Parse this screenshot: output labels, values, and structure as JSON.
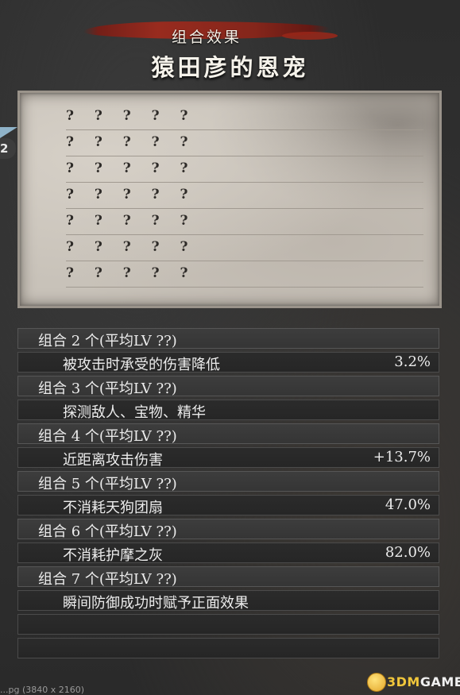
{
  "header": {
    "subtitle": "组合效果",
    "title": "猿田彦的恩宠"
  },
  "side_tab": {
    "badge": "2"
  },
  "unknown_slots": [
    "? ? ? ? ?",
    "? ? ? ? ?",
    "? ? ? ? ?",
    "? ? ? ? ?",
    "? ? ? ? ?",
    "? ? ? ? ?",
    "? ? ? ? ?"
  ],
  "combos": [
    {
      "header": "组合 2 个(平均LV  ??)",
      "effect": "被攻击时承受的伤害降低",
      "value": "3.2%"
    },
    {
      "header": "组合 3 个(平均LV  ??)",
      "effect": "探测敌人、宝物、精华",
      "value": ""
    },
    {
      "header": "组合 4 个(平均LV  ??)",
      "effect": "近距离攻击伤害",
      "value": "+13.7%"
    },
    {
      "header": "组合 5 个(平均LV  ??)",
      "effect": "不消耗天狗团扇",
      "value": "47.0%"
    },
    {
      "header": "组合 6 个(平均LV  ??)",
      "effect": "不消耗护摩之灰",
      "value": "82.0%"
    },
    {
      "header": "组合 7 个(平均LV  ??)",
      "effect": "瞬间防御成功时赋予正面效果",
      "value": ""
    }
  ],
  "footer": {
    "filename_fragment": "...pg (3840 x 2160)"
  },
  "watermark": {
    "prefix": "3DM",
    "suffix": "GAME"
  },
  "colors": {
    "accent_red": "#a32a1c",
    "parchment": "#c8c2b9",
    "row_bg": "#3a3a3a",
    "text": "#ececec"
  }
}
